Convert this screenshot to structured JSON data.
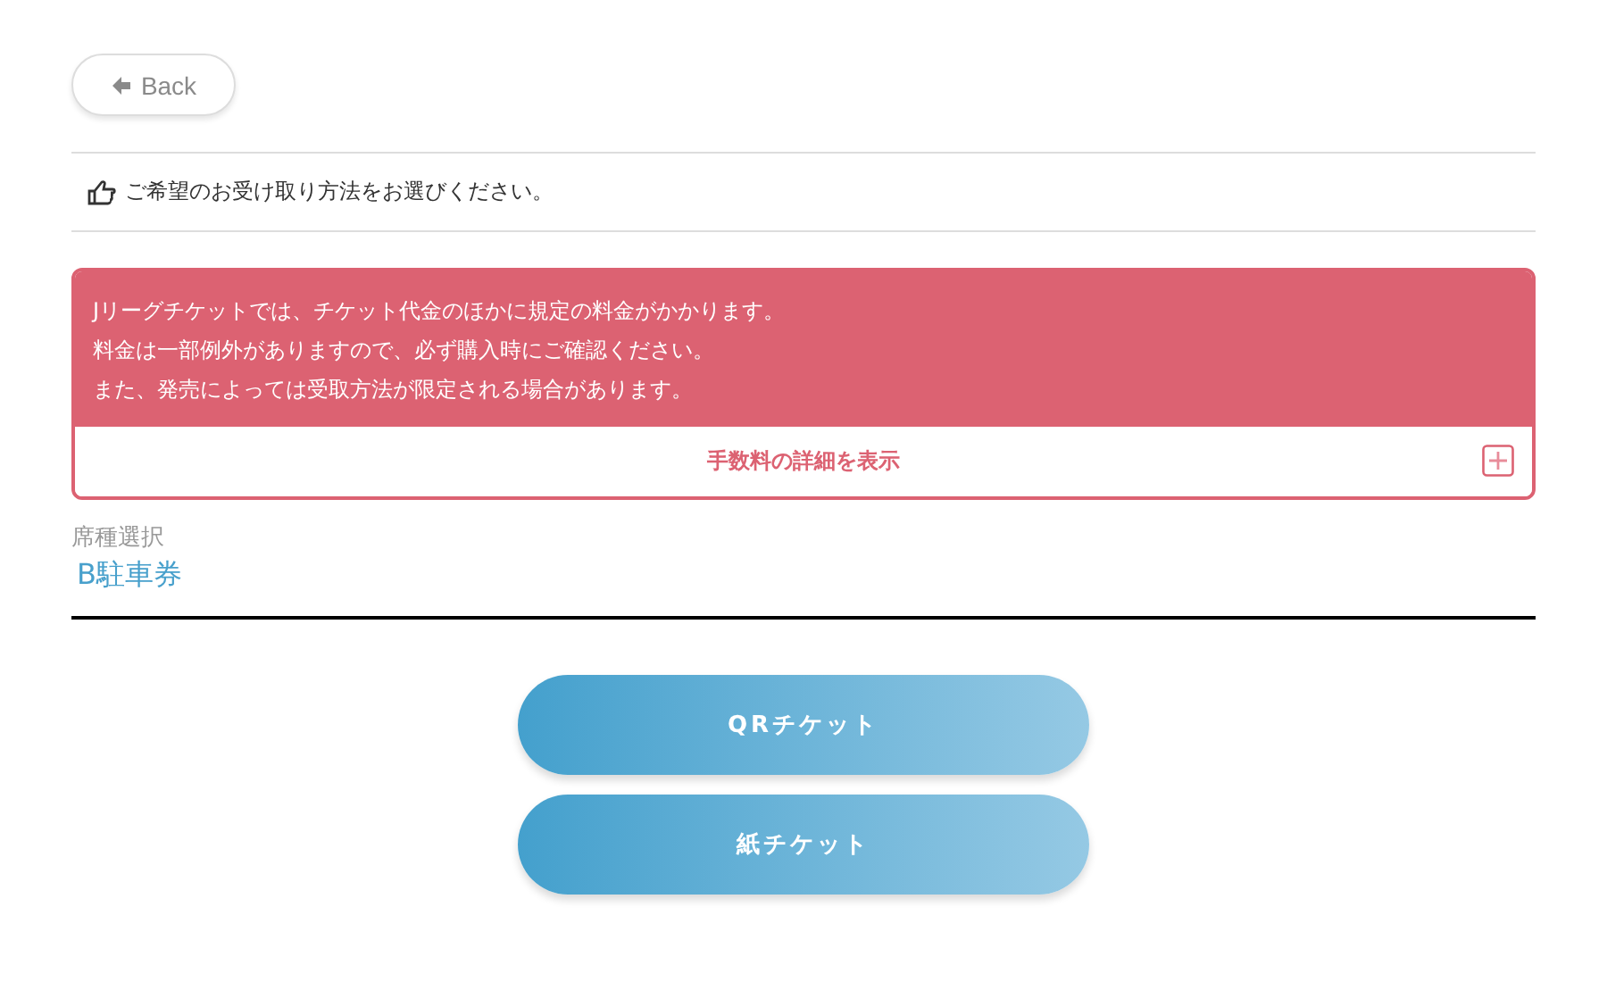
{
  "back_button": {
    "label": "Back"
  },
  "instruction": "ご希望のお受け取り方法をお選びください。",
  "notice": {
    "lines": [
      "Jリーグチケットでは、チケット代金のほかに規定の料金がかかります。",
      "料金は一部例外がありますので、必ず購入時にご確認ください。",
      "また、発売によっては受取方法が限定される場合があります。"
    ],
    "details_toggle": {
      "label": "手数料の詳細を表示",
      "expanded": false
    }
  },
  "seat": {
    "label": "席種選択",
    "value": "B駐車券"
  },
  "options": [
    {
      "label": "QRチケット"
    },
    {
      "label": "紙チケット"
    }
  ]
}
